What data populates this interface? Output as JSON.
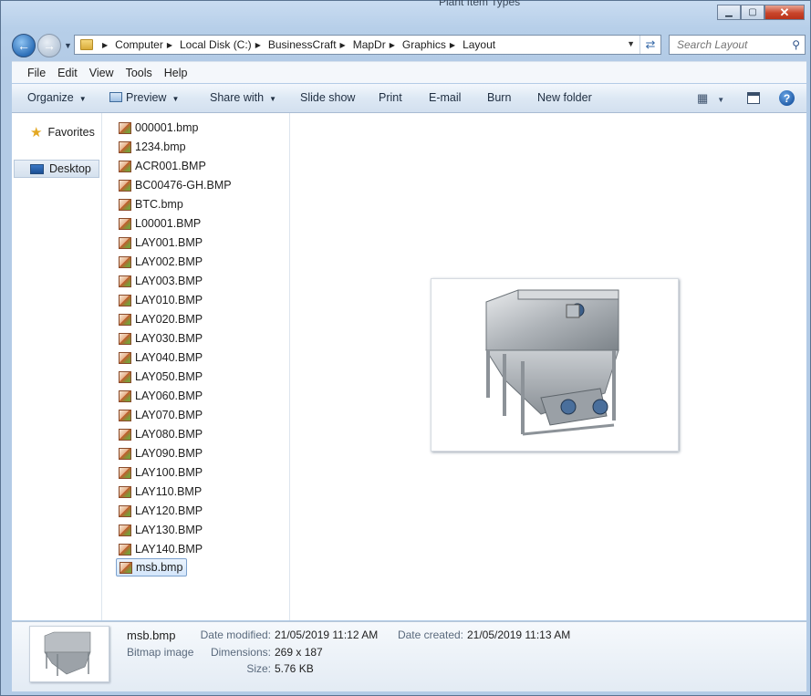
{
  "window": {
    "title_ghost": "Plant Item Types",
    "minimize_glyph": "▁",
    "maximize_glyph": "▢",
    "close_glyph": "✕"
  },
  "address": {
    "crumbs": [
      "Computer",
      "Local Disk (C:)",
      "BusinessCraft",
      "MapDr",
      "Graphics",
      "Layout"
    ]
  },
  "search": {
    "placeholder": "Search Layout"
  },
  "menu": [
    "File",
    "Edit",
    "View",
    "Tools",
    "Help"
  ],
  "toolbar": {
    "organize": "Organize",
    "preview": "Preview",
    "share_with": "Share with",
    "slide_show": "Slide show",
    "print": "Print",
    "email": "E-mail",
    "burn": "Burn",
    "new_folder": "New folder"
  },
  "navpane": {
    "favorites": "Favorites",
    "desktop": "Desktop"
  },
  "files": [
    "000001.bmp",
    "1234.bmp",
    "ACR001.BMP",
    "BC00476-GH.BMP",
    "BTC.bmp",
    "L00001.BMP",
    "LAY001.BMP",
    "LAY002.BMP",
    "LAY003.BMP",
    "LAY010.BMP",
    "LAY020.BMP",
    "LAY030.BMP",
    "LAY040.BMP",
    "LAY050.BMP",
    "LAY060.BMP",
    "LAY070.BMP",
    "LAY080.BMP",
    "LAY090.BMP",
    "LAY100.BMP",
    "LAY110.BMP",
    "LAY120.BMP",
    "LAY130.BMP",
    "LAY140.BMP",
    "msb.bmp"
  ],
  "selected_file": "msb.bmp",
  "details": {
    "name": "msb.bmp",
    "type": "Bitmap image",
    "date_modified_label": "Date modified:",
    "date_modified": "21/05/2019 11:12 AM",
    "dimensions_label": "Dimensions:",
    "dimensions": "269 x 187",
    "size_label": "Size:",
    "size": "5.76 KB",
    "date_created_label": "Date created:",
    "date_created": "21/05/2019 11:13 AM"
  },
  "icons": {
    "back": "back-arrow-icon",
    "forward": "forward-arrow-icon",
    "refresh": "refresh-icon",
    "search": "magnifier-icon",
    "help": "help-icon"
  }
}
